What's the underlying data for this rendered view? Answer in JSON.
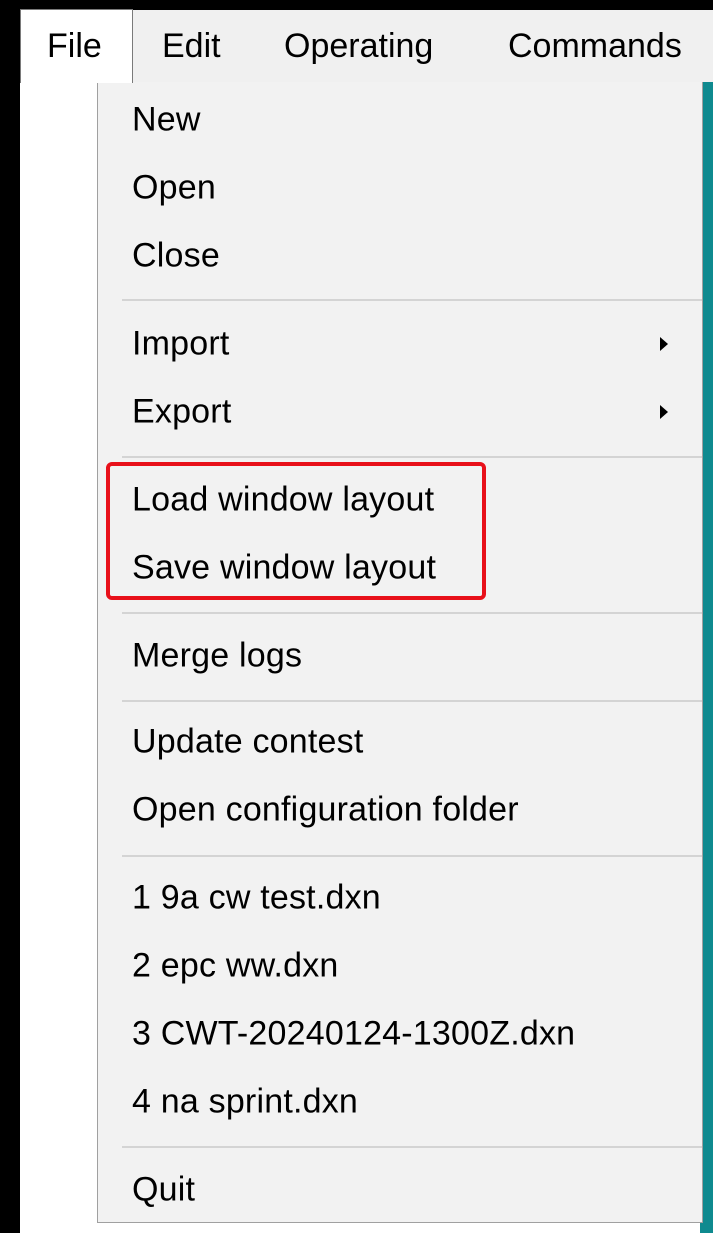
{
  "menubar": {
    "items": [
      {
        "label": "File"
      },
      {
        "label": "Edit"
      },
      {
        "label": "Operating"
      },
      {
        "label": "Commands"
      }
    ]
  },
  "file_menu": {
    "groups": {
      "file_ops": {
        "new": "New",
        "open": "Open",
        "close": "Close"
      },
      "transfer": {
        "import": "Import",
        "export": "Export"
      },
      "layout": {
        "load": "Load window layout",
        "save": "Save window layout"
      },
      "merge": {
        "merge_logs": "Merge logs"
      },
      "contest": {
        "update": "Update contest",
        "open_config": "Open configuration folder"
      },
      "recent": [
        "1 9a cw test.dxn",
        "2 epc ww.dxn",
        "3 CWT-20240124-1300Z.dxn",
        "4 na sprint.dxn"
      ],
      "exit": {
        "quit": "Quit"
      }
    }
  },
  "colors": {
    "highlight_border": "#e8101a",
    "menu_background": "#f2f2f2",
    "accent_teal": "#0f8a8f"
  }
}
